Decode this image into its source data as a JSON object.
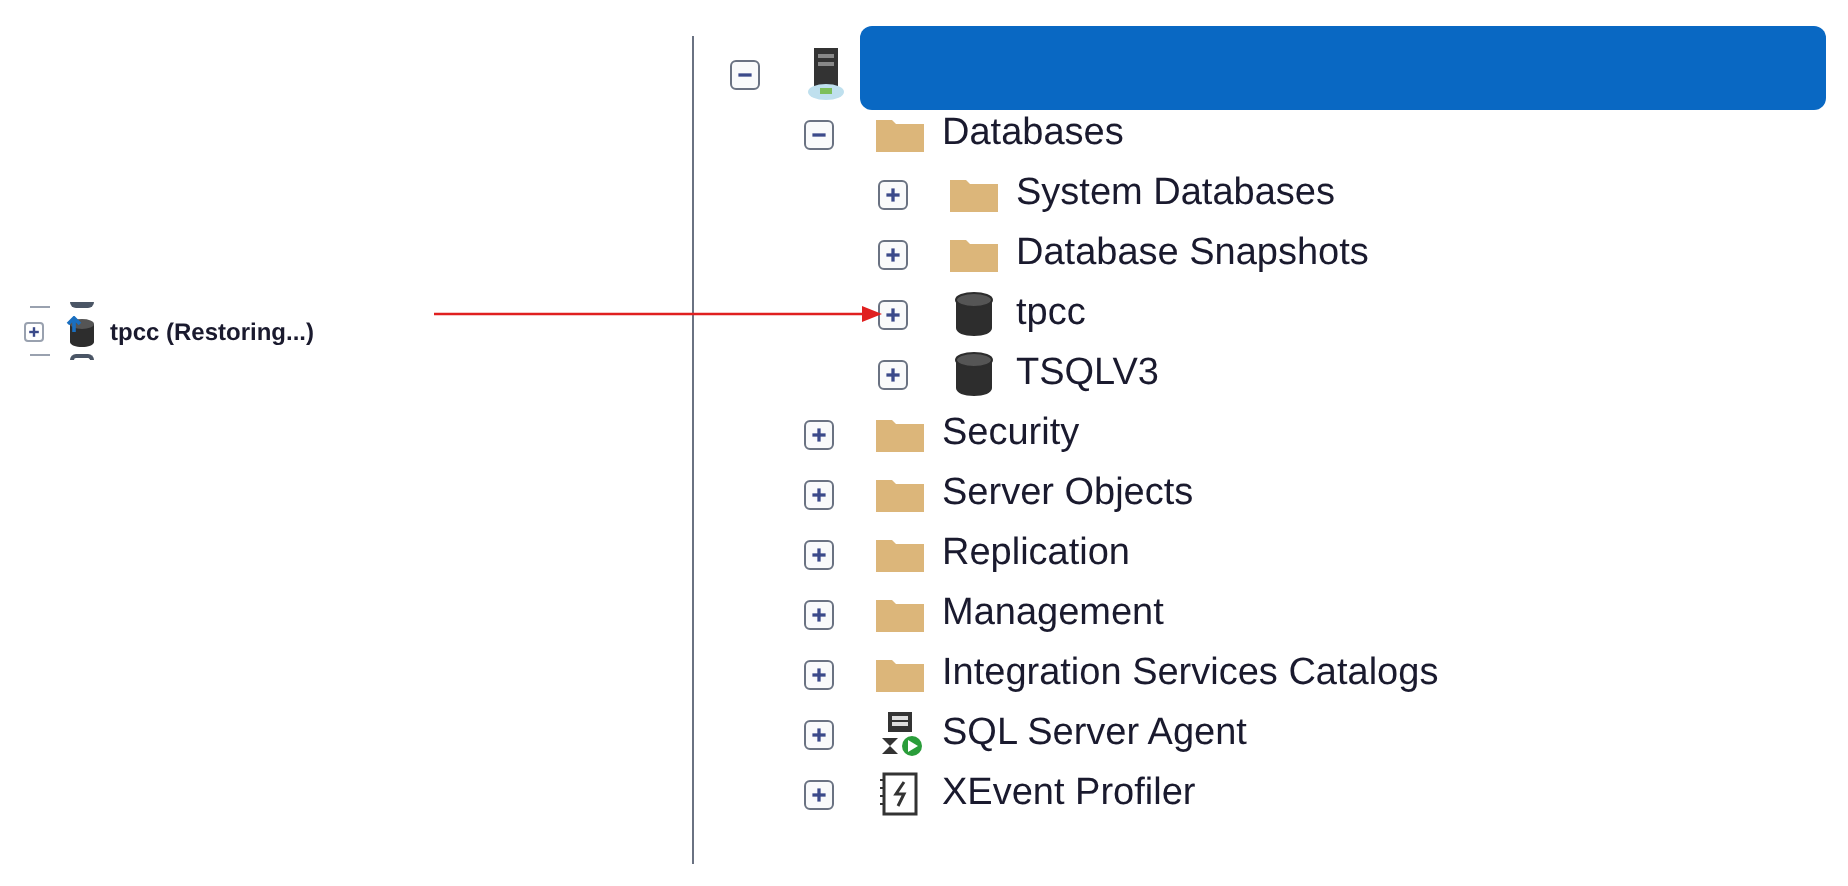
{
  "left_panel": {
    "items": [
      {
        "kind": "database_restoring",
        "label": "tpcc (Restoring...)",
        "expanded": false
      }
    ]
  },
  "object_explorer": {
    "tree": [
      {
        "kind": "server",
        "name_hidden": true,
        "expanded": true,
        "children": [
          {
            "kind": "folder",
            "label": "Databases",
            "expanded": true,
            "children": [
              {
                "kind": "folder",
                "label": "System Databases",
                "expanded": false
              },
              {
                "kind": "folder",
                "label": "Database Snapshots",
                "expanded": false
              },
              {
                "kind": "database",
                "label": "tpcc",
                "expanded": false
              },
              {
                "kind": "database",
                "label": "TSQLV3",
                "expanded": false
              }
            ]
          },
          {
            "kind": "folder",
            "label": "Security",
            "expanded": false
          },
          {
            "kind": "folder",
            "label": "Server Objects",
            "expanded": false
          },
          {
            "kind": "folder",
            "label": "Replication",
            "expanded": false
          },
          {
            "kind": "folder",
            "label": "Management",
            "expanded": false
          },
          {
            "kind": "folder",
            "label": "Integration Services Catalogs",
            "expanded": false
          },
          {
            "kind": "agent",
            "label": "SQL Server Agent",
            "expanded": false
          },
          {
            "kind": "xevent",
            "label": "XEvent Profiler",
            "expanded": false
          }
        ]
      }
    ]
  }
}
